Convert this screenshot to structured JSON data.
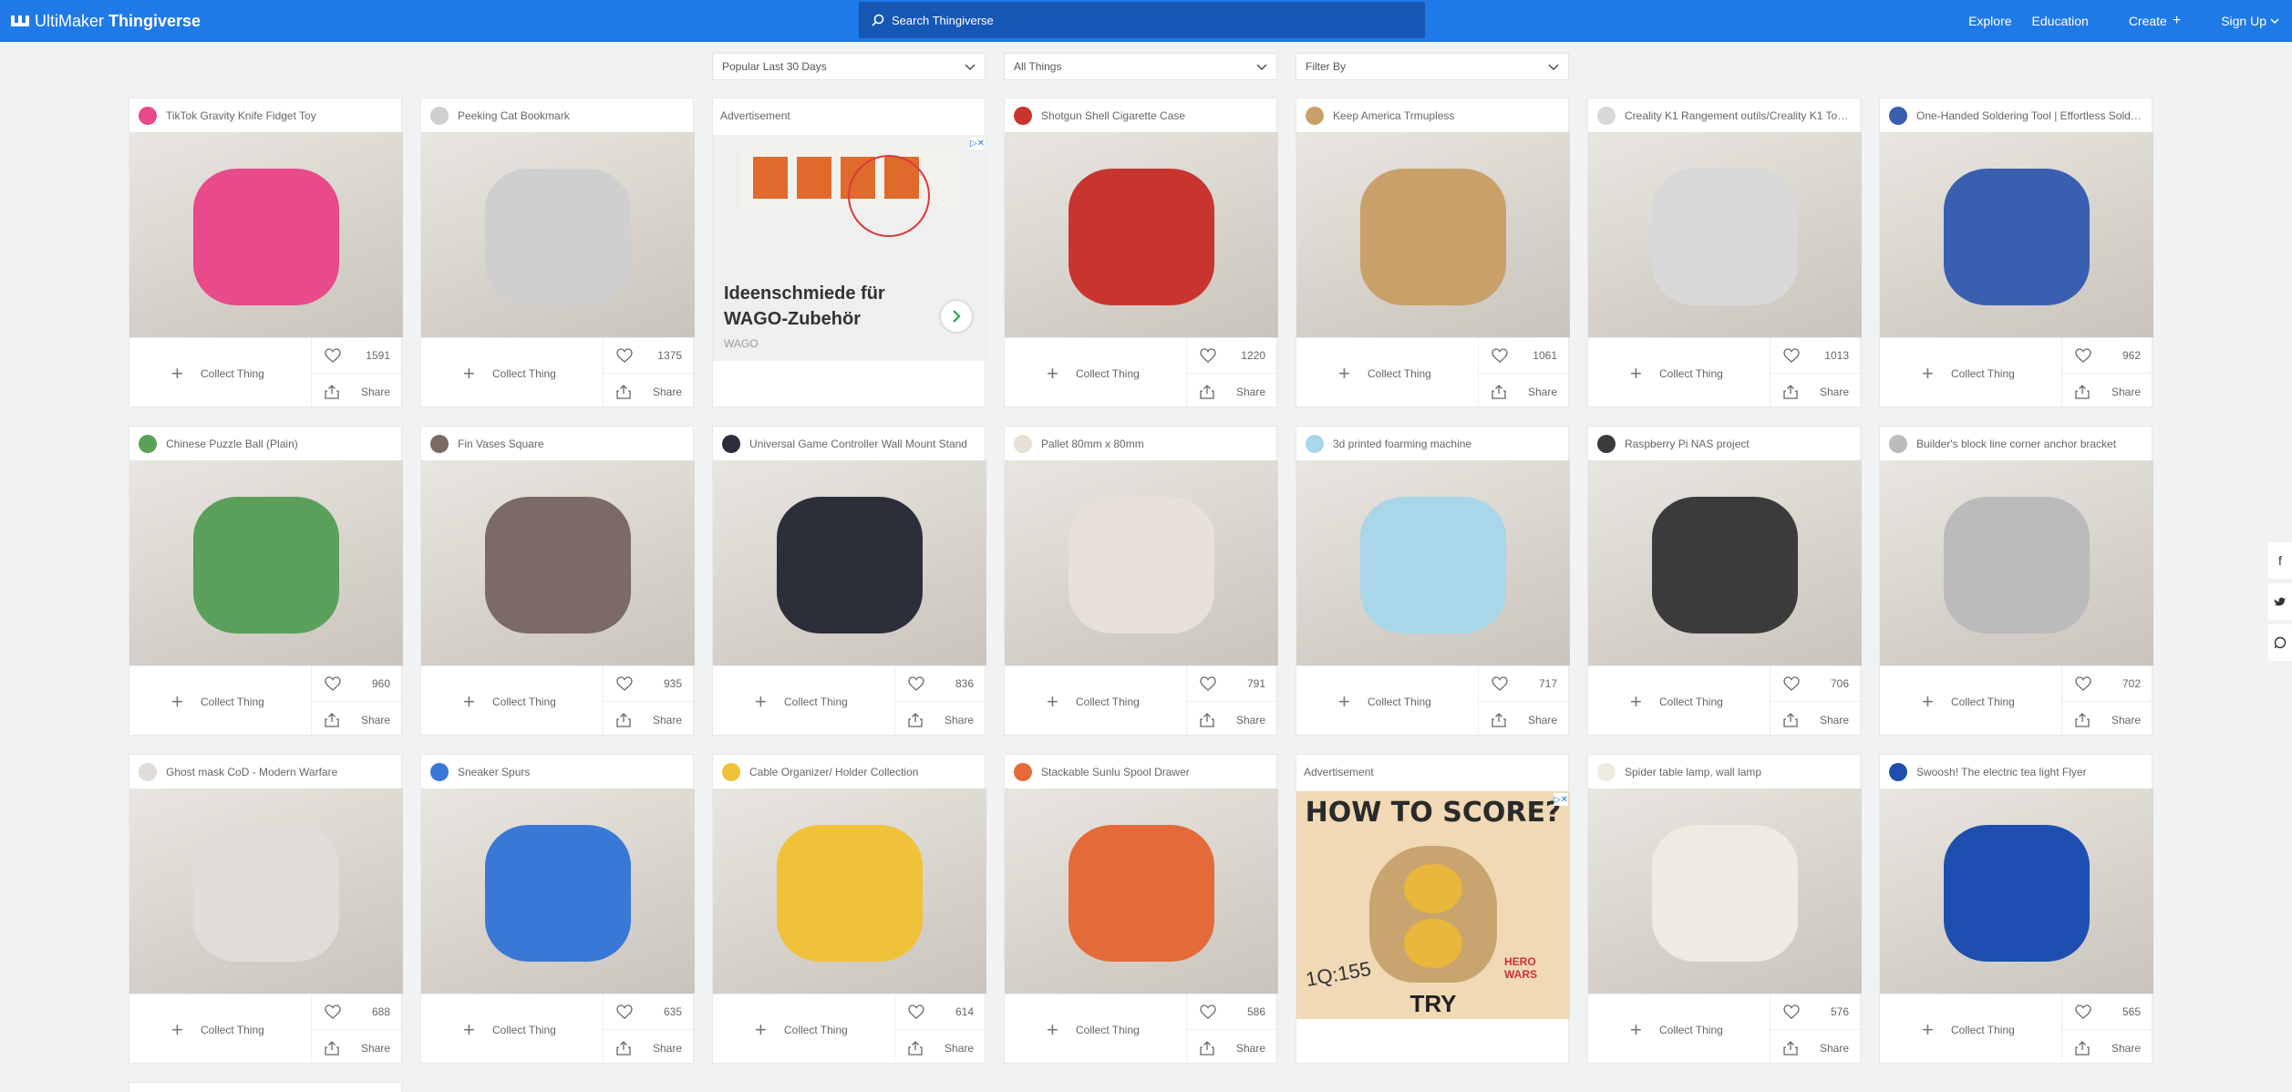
{
  "header": {
    "brand_prefix": "UltiMaker",
    "brand_name": "Thingiverse",
    "search_placeholder": "Search Thingiverse",
    "nav": [
      "Explore",
      "Education",
      "Create",
      "Sign Up"
    ]
  },
  "filters": [
    "Popular Last 30 Days",
    "All Things",
    "Filter By"
  ],
  "actions": {
    "collect": "Collect Thing",
    "share": "Share"
  },
  "ads": [
    {
      "label": "Advertisement",
      "headline": "Ideenschmiede für WAGO-Zubehör",
      "brand": "WAGO"
    },
    {
      "label": "Advertisement",
      "headline": "HOW TO SCORE?",
      "score": "1Q:155",
      "cta": "TRY",
      "brand": "HERO WARS"
    }
  ],
  "things": [
    {
      "title": "TikTok Gravity Knife Fidget Toy",
      "likes": "1591",
      "color": "#e84a8a"
    },
    {
      "title": "Peeking Cat Bookmark",
      "likes": "1375",
      "color": "#cfcfcf"
    },
    {
      "title": "Shotgun Shell Cigarette Case",
      "likes": "1220",
      "color": "#c8352f"
    },
    {
      "title": "Keep America Trmupless",
      "likes": "1061",
      "color": "#c9a06a"
    },
    {
      "title": "Creality K1 Rangement outils/Creality K1 Tool Storage",
      "likes": "1013",
      "color": "#d8d8d8"
    },
    {
      "title": "One-Handed Soldering Tool | Effortless Soldering",
      "likes": "962",
      "color": "#3a5fb0"
    },
    {
      "title": "Chinese Puzzle Ball (Plain)",
      "likes": "960",
      "color": "#5aa05a"
    },
    {
      "title": "Fin Vases Square",
      "likes": "935",
      "color": "#7b6a66"
    },
    {
      "title": "Universal Game Controller Wall Mount Stand",
      "likes": "836",
      "color": "#2c2f3a"
    },
    {
      "title": "Pallet 80mm x 80mm",
      "likes": "791",
      "color": "#e6e0d6"
    },
    {
      "title": "3d printed foarming machine",
      "likes": "717",
      "color": "#a9d6e8"
    },
    {
      "title": "Raspberry Pi NAS project",
      "likes": "706",
      "color": "#3b3b3b"
    },
    {
      "title": "Builder's block line corner anchor bracket",
      "likes": "702",
      "color": "#bbbbbb"
    },
    {
      "title": "Ghost mask CoD - Modern Warfare",
      "likes": "688",
      "color": "#e0ddd8"
    },
    {
      "title": "Sneaker Spurs",
      "likes": "635",
      "color": "#3a78d6"
    },
    {
      "title": "Cable Organizer/ Holder Collection",
      "likes": "614",
      "color": "#f0c23a"
    },
    {
      "title": "Stackable Sunlu Spool Drawer",
      "likes": "586",
      "color": "#e46a3a"
    },
    {
      "title": "Spider table lamp, wall lamp",
      "likes": "576",
      "color": "#efeae2"
    },
    {
      "title": "Swoosh! The electric tea light Flyer",
      "likes": "565",
      "color": "#1e4fb0"
    }
  ],
  "colors": {
    "header": "#1f7ae8",
    "search": "#1557b3",
    "background": "#f1f2f4"
  }
}
